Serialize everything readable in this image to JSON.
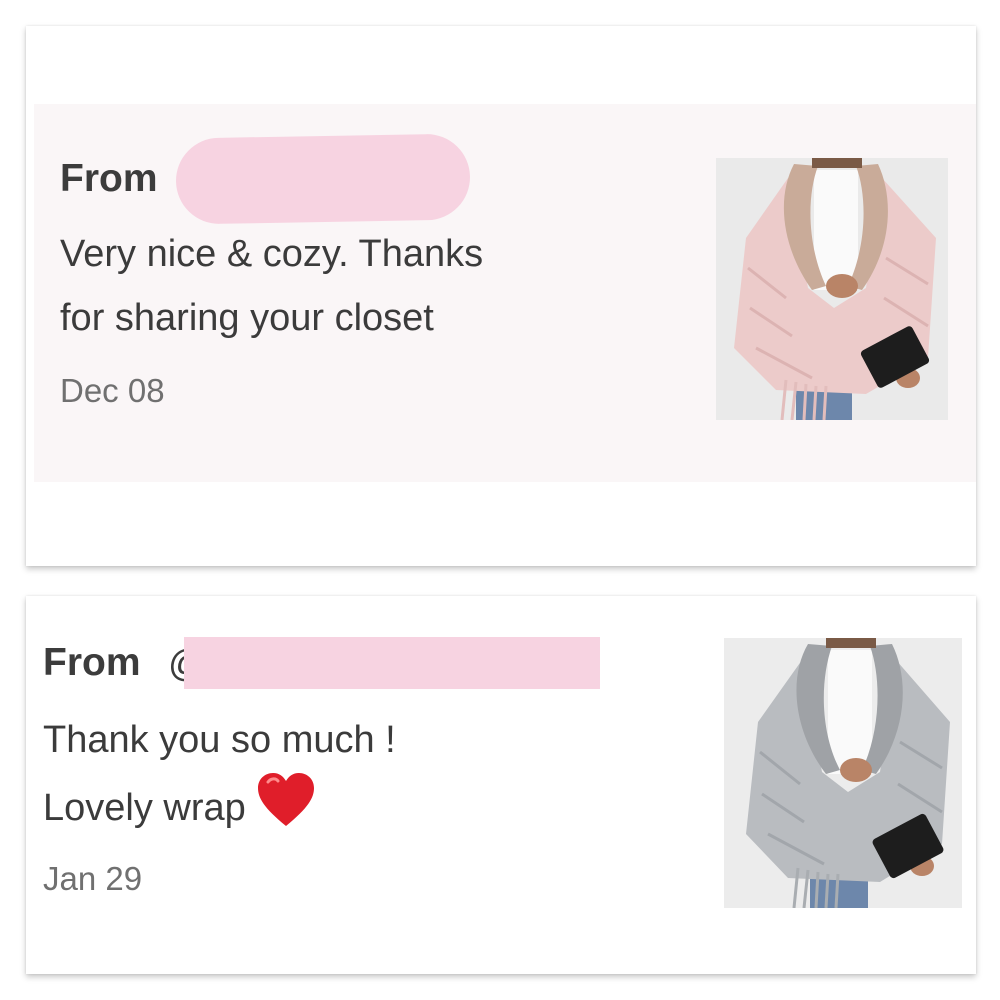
{
  "reviews": [
    {
      "from_label": "From",
      "message": "Very nice & cozy. Thanks\nfor sharing your closet",
      "date": "Dec 08",
      "thumbnail": "pink-fringed-wrap-thumbnail",
      "wrap_color": "#eccbca"
    },
    {
      "from_label": "From",
      "at_prefix": "@",
      "message": "Thank you so much !\nLovely wrap",
      "message_icon": "red-heart-icon",
      "date": "Jan 29",
      "thumbnail": "grey-fringed-wrap-thumbnail",
      "wrap_color": "#b9bcc0"
    }
  ],
  "colors": {
    "redaction": "#f7d3e1",
    "card_tint": "#faf6f7",
    "heart": "#e01e2a"
  }
}
